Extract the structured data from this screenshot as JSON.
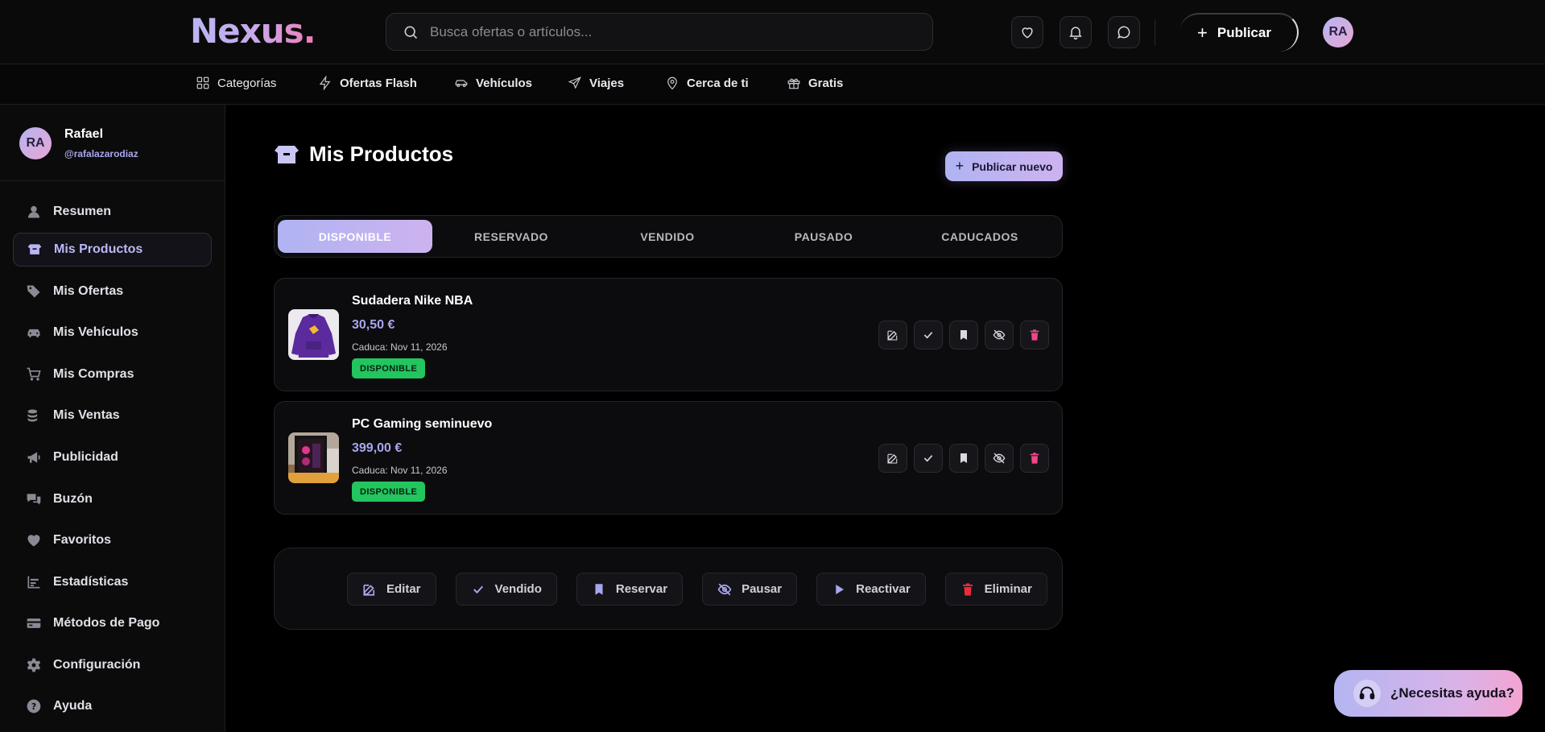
{
  "header": {
    "logo": "Nexus.",
    "search_placeholder": "Busca ofertas o artículos...",
    "publish_label": "Publicar",
    "avatar_initials": "RA"
  },
  "categories": [
    {
      "label": "Categorías",
      "icon": "grid-icon"
    },
    {
      "label": "Ofertas Flash",
      "icon": "lightning-icon"
    },
    {
      "label": "Vehículos",
      "icon": "car-icon"
    },
    {
      "label": "Viajes",
      "icon": "plane-icon"
    },
    {
      "label": "Cerca de ti",
      "icon": "location-pin-icon"
    },
    {
      "label": "Gratis",
      "icon": "gift-icon"
    }
  ],
  "sidebar": {
    "profile": {
      "initials": "RA",
      "name": "Rafael",
      "handle": "@rafalazarodiaz"
    },
    "items": [
      {
        "label": "Resumen",
        "icon": "user-icon"
      },
      {
        "label": "Mis Productos",
        "icon": "box-icon",
        "active": true
      },
      {
        "label": "Mis Ofertas",
        "icon": "tags-icon"
      },
      {
        "label": "Mis Vehículos",
        "icon": "car-icon"
      },
      {
        "label": "Mis Compras",
        "icon": "cart-icon"
      },
      {
        "label": "Mis Ventas",
        "icon": "coins-icon"
      },
      {
        "label": "Publicidad",
        "icon": "megaphone-icon"
      },
      {
        "label": "Buzón",
        "icon": "chat-bubbles-icon"
      },
      {
        "label": "Favoritos",
        "icon": "heart-icon"
      },
      {
        "label": "Estadísticas",
        "icon": "bar-chart-icon"
      },
      {
        "label": "Métodos de Pago",
        "icon": "credit-card-icon"
      },
      {
        "label": "Configuración",
        "icon": "gear-icon"
      },
      {
        "label": "Ayuda",
        "icon": "question-circle-icon"
      }
    ]
  },
  "main": {
    "title": "Mis Productos",
    "new_button": "Publicar nuevo",
    "tabs": [
      {
        "label": "DISPONIBLE",
        "active": true
      },
      {
        "label": "RESERVADO"
      },
      {
        "label": "VENDIDO"
      },
      {
        "label": "PAUSADO"
      },
      {
        "label": "CADUCADOS"
      }
    ],
    "products": [
      {
        "title": "Sudadera Nike NBA",
        "price": "30,50 €",
        "expires": "Caduca: Nov 11, 2026",
        "status": "DISPONIBLE"
      },
      {
        "title": "PC Gaming seminuevo",
        "price": "399,00 €",
        "expires": "Caduca: Nov 11, 2026",
        "status": "DISPONIBLE"
      }
    ],
    "legend": [
      {
        "label": "Editar",
        "icon": "edit-icon"
      },
      {
        "label": "Vendido",
        "icon": "check-icon"
      },
      {
        "label": "Reservar",
        "icon": "bookmark-icon"
      },
      {
        "label": "Pausar",
        "icon": "eye-slash-icon"
      },
      {
        "label": "Reactivar",
        "icon": "play-icon"
      },
      {
        "label": "Eliminar",
        "icon": "trash-icon"
      }
    ]
  },
  "help_button": "¿Necesitas ayuda?",
  "colors": {
    "accent": "#b0b3f2",
    "accent_pink": "#f07ab8",
    "status_green": "#22c55e",
    "danger": "#f0468a",
    "background": "#000000"
  }
}
